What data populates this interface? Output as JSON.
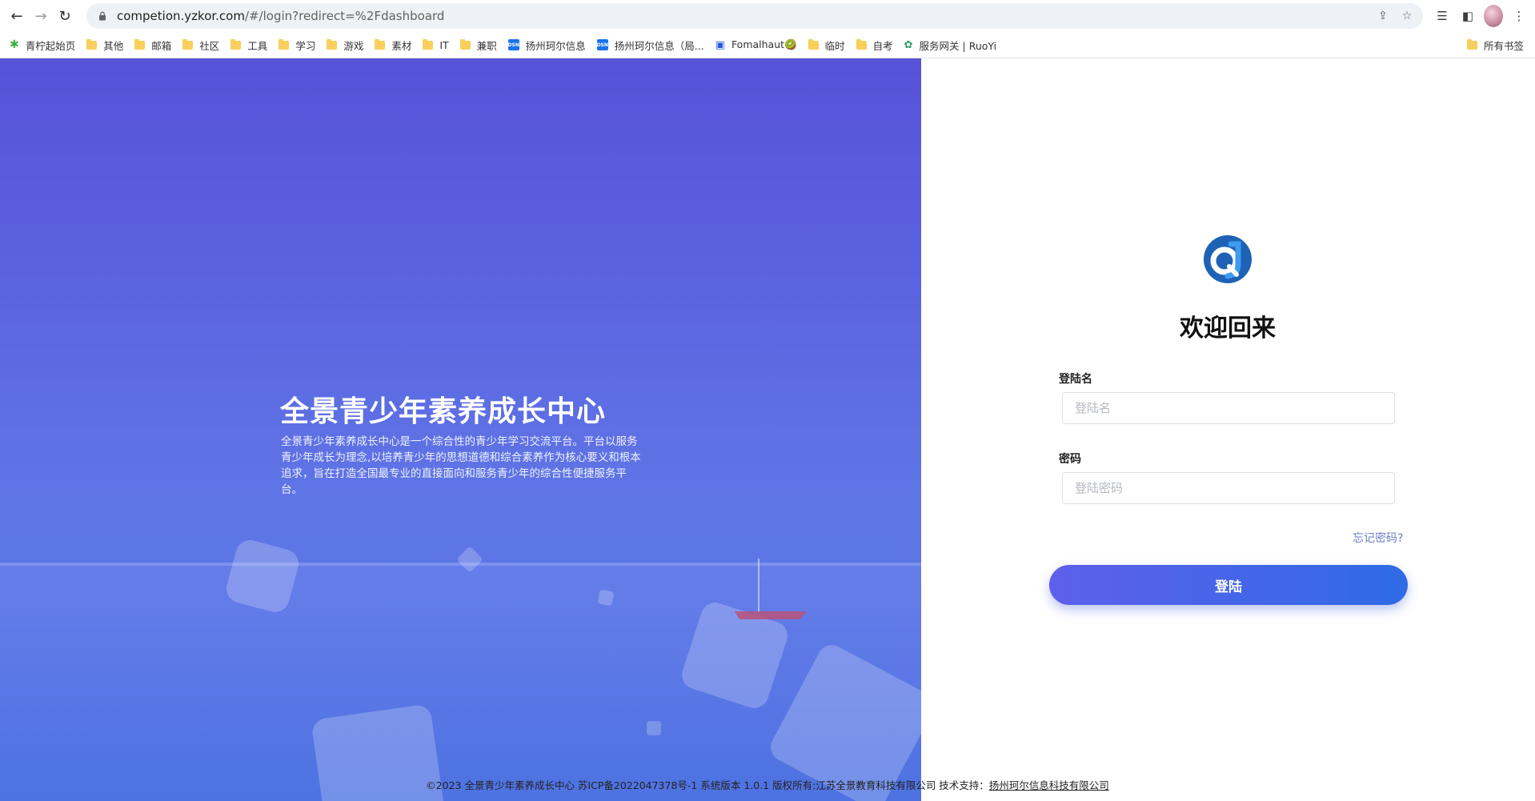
{
  "browser": {
    "url_host": "competion.yzkor.com",
    "url_path": "/#/login?redirect=%2Fdashboard",
    "bookmarks": [
      {
        "label": "青柠起始页",
        "icon": "lime-icon"
      },
      {
        "label": "其他",
        "icon": "folder-icon"
      },
      {
        "label": "邮箱",
        "icon": "folder-icon"
      },
      {
        "label": "社区",
        "icon": "folder-icon"
      },
      {
        "label": "工具",
        "icon": "folder-icon"
      },
      {
        "label": "学习",
        "icon": "folder-icon"
      },
      {
        "label": "游戏",
        "icon": "folder-icon"
      },
      {
        "label": "素材",
        "icon": "folder-icon"
      },
      {
        "label": "IT",
        "icon": "folder-icon"
      },
      {
        "label": "兼职",
        "icon": "folder-icon"
      },
      {
        "label": "扬州珂尔信息",
        "icon": "dsn-icon"
      },
      {
        "label": "扬州珂尔信息（局...",
        "icon": "dsn-icon"
      },
      {
        "label": "Fomalhaut🥝",
        "icon": "cup-icon"
      },
      {
        "label": "临时",
        "icon": "folder-icon"
      },
      {
        "label": "自考",
        "icon": "folder-icon"
      },
      {
        "label": "服务网关 | RuoYi",
        "icon": "leaf-icon"
      }
    ],
    "all_bookmarks": "所有书签"
  },
  "hero": {
    "title": "全景青少年素养成长中心",
    "description": "全景青少年素养成长中心是一个综合性的青少年学习交流平台。平台以服务青少年成长为理念,以培养青少年的思想道德和综合素养作为核心要义和根本追求，旨在打造全国最专业的直接面向和服务青少年的综合性便捷服务平台。"
  },
  "login": {
    "welcome": "欢迎回来",
    "username_label": "登陆名",
    "username_placeholder": "登陆名",
    "password_label": "密码",
    "password_placeholder": "登陆密码",
    "forgot": "忘记密码?",
    "submit": "登陆"
  },
  "footer": {
    "text": "©2023 全景青少年素养成长中心 苏ICP备2022047378号-1 系统版本 1.0.1 版权所有:江苏全景教育科技有限公司 技术支持：",
    "link": "扬州珂尔信息科技有限公司"
  },
  "colors": {
    "hero_gradient_top": "#5752d8",
    "hero_gradient_bottom": "#4f73e2",
    "button_start": "#5d60ea",
    "button_end": "#2f6ae5",
    "link": "#6b7dc6"
  }
}
